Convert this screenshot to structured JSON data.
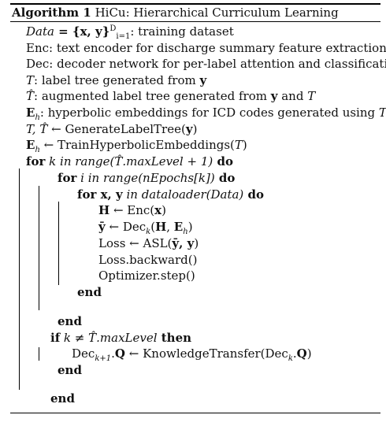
{
  "algorithm": {
    "caption_label": "Algorithm 1",
    "caption_title": "HiCu: Hierarchical Curriculum Learning"
  },
  "lines": {
    "l1": {
      "var": "Data",
      "math": " = {x, y}",
      "sup": "D",
      "sub": "i=1",
      "rest": ": training dataset"
    },
    "l2": {
      "text": "Enc: text encoder for discharge summary feature extraction"
    },
    "l3": {
      "text": "Dec: decoder network for per-label attention and classification"
    },
    "l4": {
      "var": "T",
      "rest1": ": label tree generated from ",
      "bold": "y"
    },
    "l5": {
      "var": "T̂",
      "rest1": ": augmented label tree generated from ",
      "bold": "y",
      "rest2": " and ",
      "var2": "T"
    },
    "l6": {
      "bold": "E",
      "sub": "h",
      "rest1": ": hyperbolic embeddings for ICD codes generated using ",
      "var": "T"
    },
    "l7": {
      "var": "T, T̂",
      "arrow": " ← ",
      "fn": "GenerateLabelTree(",
      "bold": "y",
      "close": ")"
    },
    "l8": {
      "bold": "E",
      "sub": "h",
      "arrow": " ← ",
      "fn": "TrainHyperbolicEmbeddings(",
      "var": "T",
      "close": ")"
    },
    "l9": {
      "kw": "for",
      "var1": " k ",
      "it": "in range(T̂.maxLevel + 1)",
      "kw2": " do"
    },
    "l10": {
      "kw": "for",
      "var1": " i ",
      "it": "in range(nEpochs[k])",
      "kw2": " do"
    },
    "l11": {
      "kw": "for",
      "bold": " x, y",
      "it": " in dataloader(Data)",
      "kw2": " do"
    },
    "l12": {
      "bold": "H",
      "arrow": " ← ",
      "fn": "Enc(",
      "bold2": "x",
      "close": ")"
    },
    "l13": {
      "bold": "ȳ",
      "arrow": " ← ",
      "fn": "Dec",
      "sub": "k",
      "open": "(",
      "bold2": "H",
      "comma": ", ",
      "bold3": "E",
      "sub2": "h",
      "close": ")"
    },
    "l14": {
      "text": "Loss ← ASL(",
      "bold": "ȳ, y",
      "close": ")"
    },
    "l15": {
      "text": "Loss.backward()"
    },
    "l16": {
      "text": "Optimizer.step()"
    },
    "l17": {
      "kw": "end"
    },
    "l18": {
      "kw": "end"
    },
    "l19": {
      "kw": "if",
      "var1": " k ≠ T̂.",
      "it": "maxLevel",
      "kw2": " then"
    },
    "l20": {
      "fn": "Dec",
      "sub": "k+1",
      "dot": ".",
      "bold": "Q",
      "arrow": " ← ",
      "fn2": "KnowledgeTransfer(Dec",
      "sub2": "k",
      "dot2": ".",
      "bold2": "Q",
      "close": ")"
    },
    "l21": {
      "kw": "end"
    },
    "l22": {
      "kw": "end"
    }
  }
}
